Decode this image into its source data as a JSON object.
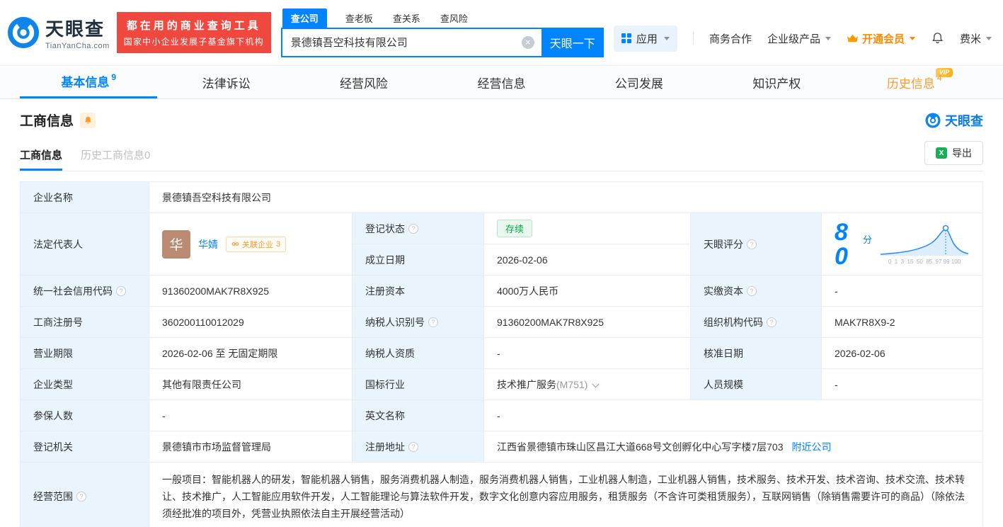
{
  "brand": {
    "name": "天眼查",
    "domain": "TianYanCha.com"
  },
  "banner": {
    "line1": "都在用的商业查询工具",
    "line2": "国家中小企业发展子基金旗下机构"
  },
  "search": {
    "tabs": [
      {
        "label": "查公司"
      },
      {
        "label": "查老板"
      },
      {
        "label": "查关系"
      },
      {
        "label": "查风险"
      }
    ],
    "query": "景德镇吾空科技有限公司",
    "submit_label": "天眼一下"
  },
  "header_nav": {
    "apps_label": "应用",
    "business_coop": "商务合作",
    "enterprise_products": "企业级产品",
    "vip_label": "开通会员",
    "username": "费米"
  },
  "tabs": [
    {
      "label": "基本信息",
      "count": "9"
    },
    {
      "label": "法律诉讼"
    },
    {
      "label": "经营风险"
    },
    {
      "label": "经营信息"
    },
    {
      "label": "公司发展"
    },
    {
      "label": "知识产权"
    },
    {
      "label": "历史信息",
      "count": "4",
      "badge": "VIP"
    }
  ],
  "section": {
    "title": "工商信息",
    "brand_mark": "天眼查",
    "subtabs": [
      {
        "label": "工商信息"
      },
      {
        "label": "历史工商信息0"
      }
    ],
    "export_label": "导出"
  },
  "fields": {
    "company_name": {
      "label": "企业名称",
      "value": "景德镇吾空科技有限公司"
    },
    "legal_rep": {
      "label": "法定代表人",
      "avatar": "华",
      "name": "华婧",
      "related_label": "关联企业",
      "related_count": "3"
    },
    "reg_status": {
      "label": "登记状态",
      "value": "存续"
    },
    "est_date": {
      "label": "成立日期",
      "value": "2026-02-06"
    },
    "score": {
      "label": "天眼评分",
      "value": "80",
      "unit": "分",
      "axis": "0  1  3  15  50  85  97 99 100"
    },
    "credit_code": {
      "label": "统一社会信用代码",
      "value": "91360200MAK7R8X925"
    },
    "reg_capital": {
      "label": "注册资本",
      "value": "4000万人民币"
    },
    "paid_capital": {
      "label": "实缴资本",
      "value": "-"
    },
    "reg_number": {
      "label": "工商注册号",
      "value": "360200110012029"
    },
    "taxpayer_id": {
      "label": "纳税人识别号",
      "value": "91360200MAK7R8X925"
    },
    "org_code": {
      "label": "组织机构代码",
      "value": "MAK7R8X9-2"
    },
    "business_term": {
      "label": "营业期限",
      "value": "2026-02-06 至 无固定期限"
    },
    "taxpayer_quality": {
      "label": "纳税人资质",
      "value": "-"
    },
    "approval_date": {
      "label": "核准日期",
      "value": "2026-02-06"
    },
    "company_type": {
      "label": "企业类型",
      "value": "其他有限责任公司"
    },
    "industry": {
      "label": "国标行业",
      "value": "技术推广服务",
      "code": "(M751)"
    },
    "staff_size": {
      "label": "人员规模",
      "value": "-"
    },
    "insured_count": {
      "label": "参保人数",
      "value": "-"
    },
    "english_name": {
      "label": "英文名称",
      "value": "-"
    },
    "reg_authority": {
      "label": "登记机关",
      "value": "景德镇市市场监督管理局"
    },
    "reg_address": {
      "label": "注册地址",
      "value": "江西省景德镇市珠山区昌江大道668号文创孵化中心写字楼7层703",
      "nearby_link": "附近公司"
    },
    "business_scope": {
      "label": "经营范围",
      "value": "一般项目：智能机器人的研发，智能机器人销售，服务消费机器人制造，服务消费机器人销售，工业机器人制造，工业机器人销售，技术服务、技术开发、技术咨询、技术交流、技术转让、技术推广，人工智能应用软件开发，人工智能理论与算法软件开发，数字文化创意内容应用服务，租赁服务（不含许可类租赁服务），互联网销售（除销售需要许可的商品）（除依法须经批准的项目外，凭营业执照依法自主开展经营活动）"
    }
  },
  "colors": {
    "brand_blue": "#0084ff",
    "banner_red": "#f0483f",
    "vip_orange": "#ff8a00",
    "status_green": "#00a848",
    "label_bg": "#e9f4fd"
  }
}
